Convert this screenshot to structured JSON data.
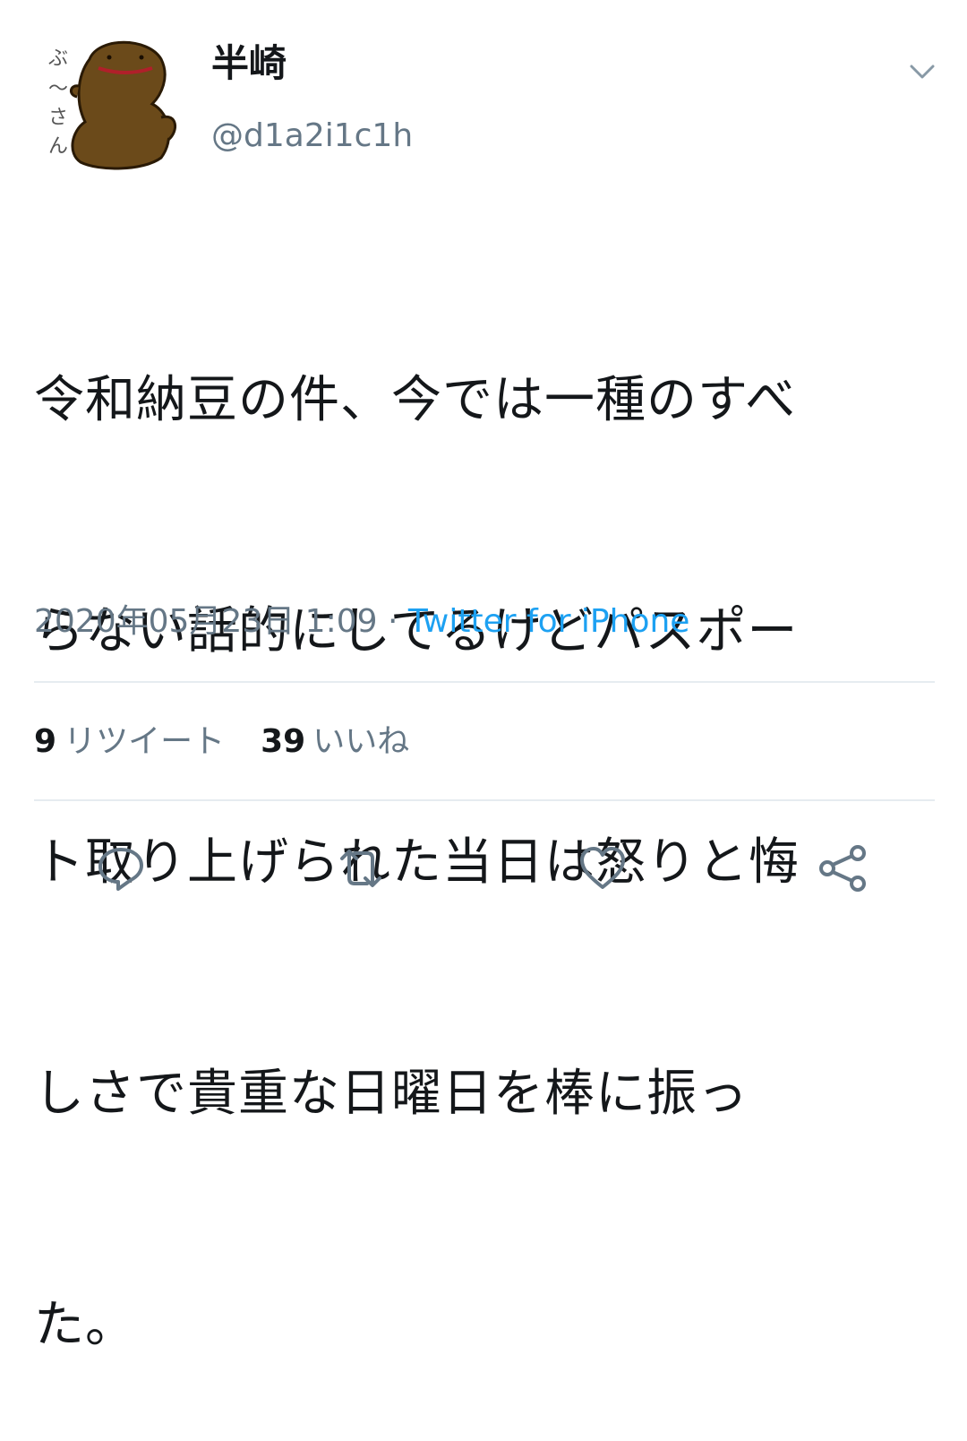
{
  "user": {
    "display_name": "半崎",
    "handle": "@d1a2i1c1h",
    "avatar_caption": "ぶ〜さん"
  },
  "tweet": {
    "text": "令和納豆の件、今では一種のすべらない話的にしてるけどパスポート取り上げられた当日は怒りと悔しさで貴重な日曜日を棒に振った。",
    "lines": [
      "令和納豆の件、今では一種のすべ",
      "らない話的にしてるけどパスポー",
      "ト取り上げられた当日は怒りと悔",
      "しさで貴重な日曜日を棒に振っ",
      "た。"
    ],
    "timestamp": "2020年05月23日 1:09",
    "separator": "·",
    "source": "Twitter for iPhone"
  },
  "stats": {
    "retweets_count": "9",
    "retweets_label": "リツイート",
    "likes_count": "39",
    "likes_label": "いいね"
  },
  "actions": {
    "reply_icon": "reply-icon",
    "retweet_icon": "retweet-icon",
    "like_icon": "heart-icon",
    "share_icon": "share-icon"
  },
  "colors": {
    "text": "#14171a",
    "secondary": "#657786",
    "link": "#1da1f2",
    "divider": "#e6ecf0",
    "avatar_brown": "#6b4a1a"
  }
}
